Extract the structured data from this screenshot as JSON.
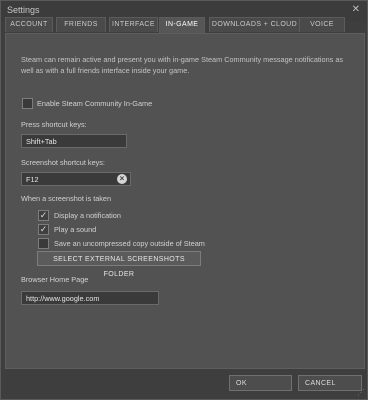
{
  "window": {
    "title": "Settings",
    "close_glyph": "✕"
  },
  "tabs": [
    {
      "label": "ACCOUNT",
      "active": false
    },
    {
      "label": "FRIENDS",
      "active": false
    },
    {
      "label": "INTERFACE",
      "active": false
    },
    {
      "label": "IN-GAME",
      "active": true
    },
    {
      "label": "DOWNLOADS + CLOUD",
      "active": false
    },
    {
      "label": "VOICE",
      "active": false
    }
  ],
  "ingame": {
    "description": "Steam can remain active and present you with in-game Steam Community message notifications as well as with a full friends interface inside your game.",
    "enable_community": {
      "label": "Enable Steam Community In-Game",
      "checked": false
    },
    "shortcut": {
      "label": "Press shortcut keys:",
      "value": "Shift+Tab"
    },
    "screenshot_shortcut": {
      "label": "Screenshot shortcut keys:",
      "value": "F12",
      "clear_glyph": "×"
    },
    "when_taken": {
      "label": "When a screenshot is taken",
      "options": [
        {
          "label": "Display a notification",
          "checked": true
        },
        {
          "label": "Play a sound",
          "checked": true
        },
        {
          "label": "Save an uncompressed copy outside of Steam",
          "checked": false
        }
      ],
      "folder_button": "SELECT EXTERNAL SCREENSHOTS FOLDER"
    },
    "browser_home": {
      "label": "Browser Home Page",
      "value": "http://www.google.com"
    }
  },
  "footer": {
    "ok": "OK",
    "cancel": "CANCEL"
  },
  "glyphs": {
    "check": "✓",
    "grip": "⋰"
  },
  "icons": {
    "close": "close-icon",
    "clear": "clear-icon",
    "check": "check-icon"
  }
}
